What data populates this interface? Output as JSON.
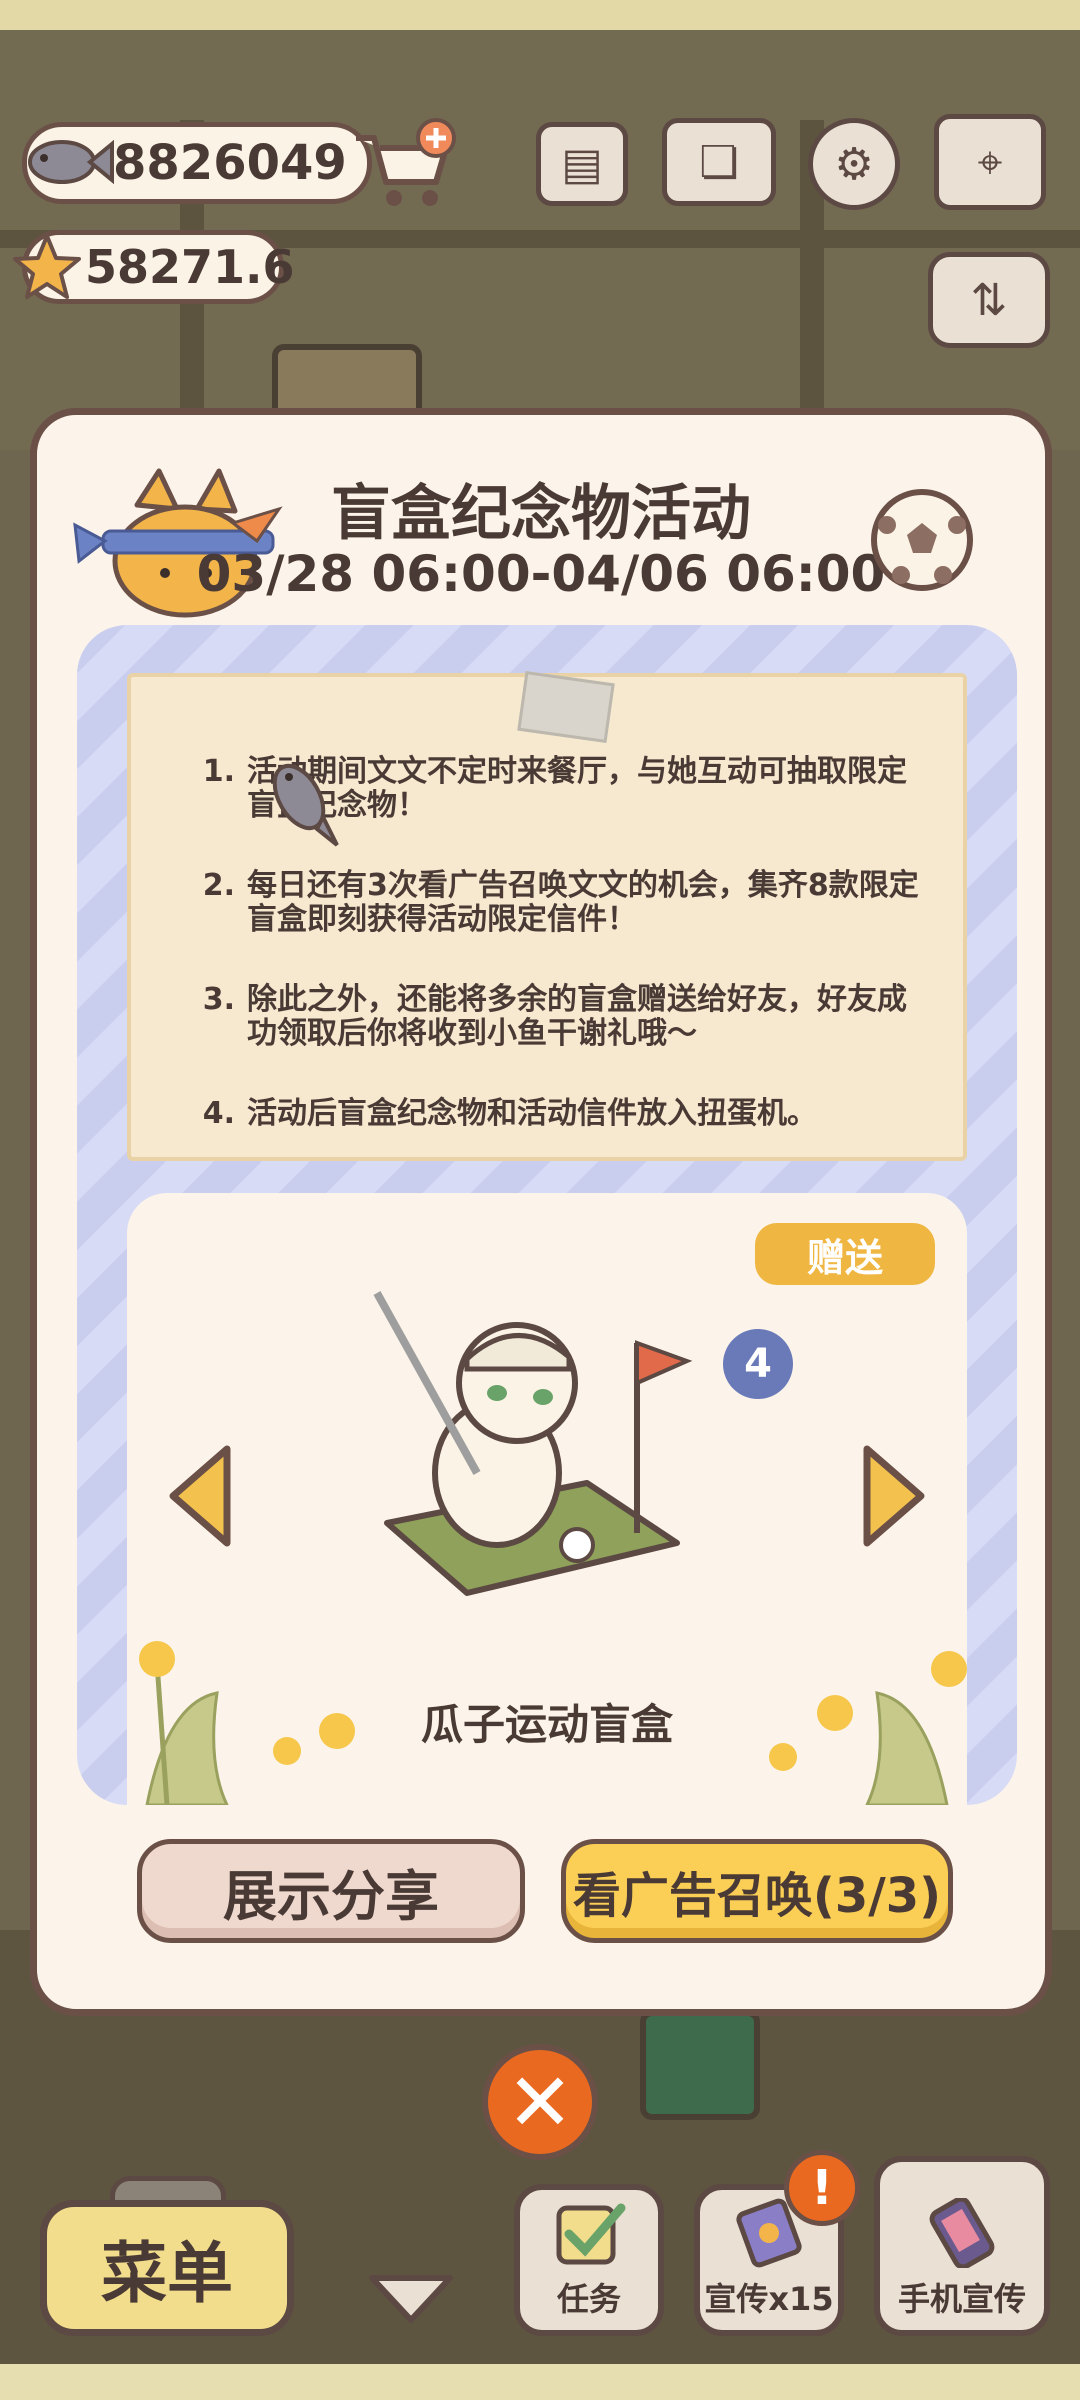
{
  "hud": {
    "fish_count": "8826049",
    "star_count": "58271.6",
    "icons": [
      "fish-icon",
      "star-icon",
      "cart-add-icon",
      "newspaper-icon",
      "book-icon",
      "gear-icon",
      "map-icon",
      "sort-toggle-icon"
    ]
  },
  "dialog": {
    "title": "盲盒纪念物活动",
    "dates": "03/28 06:00-04/06 06:00",
    "rules": [
      {
        "num": "1.",
        "text": "活动期间文文不定时来餐厅，与她互动可抽取限定盲盒纪念物！"
      },
      {
        "num": "2.",
        "text": "每日还有3次看广告召唤文文的机会，集齐8款限定盲盒即刻获得活动限定信件！"
      },
      {
        "num": "3.",
        "text": "除此之外，还能将多余的盲盒赠送给好友，好友成功领取后你将收到小鱼干谢礼哦～"
      },
      {
        "num": "4.",
        "text": "活动后盲盒纪念物和活动信件放入扭蛋机。"
      }
    ],
    "gift_label": "赠送",
    "item_count": "4",
    "item_name": "瓜子运动盲盒",
    "share_button": "展示分享",
    "watch_ad_button": "看广告召唤(3/3)"
  },
  "bottom_bar": {
    "menu_label": "菜单",
    "task_label": "任务",
    "promo_label": "宣传x15",
    "phone_promo_label": "手机宣传",
    "alert_symbol": "!"
  },
  "colors": {
    "accent_orange": "#e8691f",
    "button_yellow": "#fbcf55",
    "gift_gold": "#f0b642",
    "outline_brown": "#6b5047",
    "badge_blue": "#6a79b8"
  }
}
